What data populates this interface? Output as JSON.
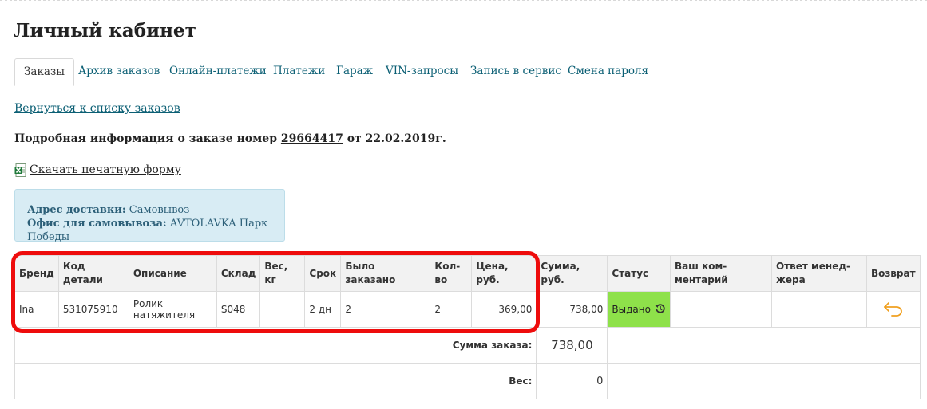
{
  "page": {
    "title": "Личный кабинет"
  },
  "tabs": [
    {
      "label": "Заказы",
      "active": true
    },
    {
      "label": "Архив заказов"
    },
    {
      "label": "Онлайн-платежи"
    },
    {
      "label": "Платежи"
    },
    {
      "label": "Гараж"
    },
    {
      "label": "VIN-запросы"
    },
    {
      "label": "Запись в сервис"
    },
    {
      "label": "Смена пароля"
    }
  ],
  "back_link": "Вернуться к списку заказов",
  "order_info": {
    "prefix": "Подробная информация о заказе номер",
    "number": "29664417",
    "suffix": "от 22.02.2019г."
  },
  "download": {
    "label": "Скачать печатную форму",
    "icon": "excel-file-icon"
  },
  "delivery": {
    "address_label": "Адрес доставки:",
    "address_value": "Самовывоз",
    "office_label": "Офис для самовывоза:",
    "office_value": "AVTOLAVKA Парк Победы"
  },
  "table": {
    "headers": {
      "brand": "Бренд",
      "code": "Код детали",
      "desc": "Описание",
      "stock": "Склад",
      "weight_1": "Вес,",
      "weight_2": "кг",
      "term": "Срок",
      "ordered_1": "Было",
      "ordered_2": "заказано",
      "qty_1": "Кол-",
      "qty_2": "во",
      "price": "Цена, руб.",
      "sum": "Сумма, руб.",
      "status": "Статус",
      "comment_1": "Ваш ком-",
      "comment_2": "ментарий",
      "answer_1": "Ответ менед-",
      "answer_2": "жера",
      "return": "Возврат"
    },
    "row": {
      "brand": "Ina",
      "code": "531075910",
      "desc_1": "Ролик",
      "desc_2": "натяжителя",
      "stock": "S048",
      "weight": "",
      "term": "2 дн",
      "ordered": "2",
      "qty": "2",
      "price": "369,00",
      "sum": "738,00",
      "status": "Выдано",
      "comment": "",
      "answer": ""
    },
    "order_sum_label": "Сумма заказа:",
    "order_sum_value": "738,00",
    "weight_label": "Вес:",
    "weight_value": "0"
  },
  "colors": {
    "link": "#0b5f74",
    "status_issued": "#8ee14a",
    "highlight": "#ee0c0c",
    "return_icon": "#f0a020",
    "address_bg": "#d8ecf4"
  }
}
